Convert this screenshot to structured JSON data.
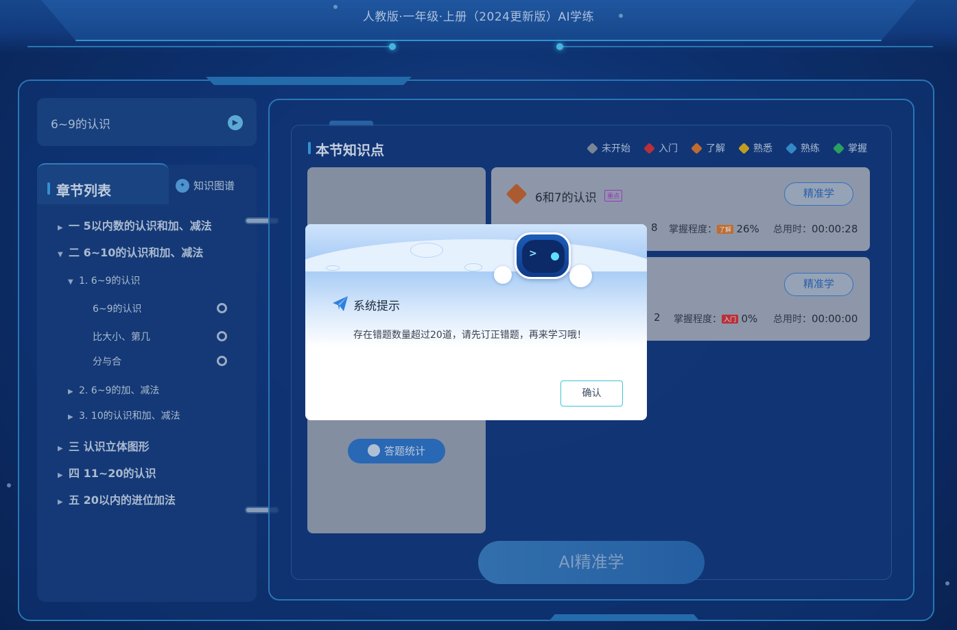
{
  "header": {
    "title": "人教版·一年级·上册（2024更新版）AI学练"
  },
  "current_lesson": {
    "title": "6~9的认识",
    "toggle_icon": "skip-icon"
  },
  "sidebar": {
    "tab_chapters": "章节列表",
    "tab_map": "知识图谱",
    "chapters": [
      {
        "label": "一 5以内数的认识和加、减法",
        "expanded": false
      },
      {
        "label": "二 6~10的认识和加、减法",
        "expanded": true,
        "sections": [
          {
            "label": "1. 6~9的认识",
            "expanded": true,
            "lessons": [
              "6~9的认识",
              "比大小、第几",
              "分与合"
            ]
          },
          {
            "label": "2. 6~9的加、减法",
            "expanded": false
          },
          {
            "label": "3. 10的认识和加、减法",
            "expanded": false
          }
        ]
      },
      {
        "label": "三 认识立体图形",
        "expanded": false
      },
      {
        "label": "四 11~20的认识",
        "expanded": false
      },
      {
        "label": "五 20以内的进位加法",
        "expanded": false
      }
    ]
  },
  "knowledge": {
    "title": "本节知识点",
    "legend": [
      {
        "label": "未开始",
        "color": "#8f98a6"
      },
      {
        "label": "入门",
        "color": "#d8343a"
      },
      {
        "label": "了解",
        "color": "#e07b2c"
      },
      {
        "label": "熟悉",
        "color": "#e2b51c"
      },
      {
        "label": "熟练",
        "color": "#3b9de0"
      },
      {
        "label": "掌握",
        "color": "#2fb865"
      }
    ],
    "cards": [
      {
        "name": "6和7的认识",
        "tag": "重点",
        "button": "精准学",
        "count": "8",
        "mastery_label": "掌握程度：",
        "level": "了解",
        "level_color": "#e07b2c",
        "percent": "26%",
        "time_label": "总用时：",
        "time": "00:00:28"
      },
      {
        "name": "",
        "tag": "",
        "button": "精准学",
        "count": "2",
        "mastery_label": "掌握程度：",
        "level": "入门",
        "level_color": "#d8343a",
        "percent": "0%",
        "time_label": "总用时：",
        "time": "00:00:00"
      }
    ],
    "stats_button": "答题统计",
    "ai_button": "AI精准学"
  },
  "dialog": {
    "title": "系统提示",
    "message": "存在错题数量超过20道，请先订正错题，再来学习哦！",
    "confirm": "确认"
  }
}
